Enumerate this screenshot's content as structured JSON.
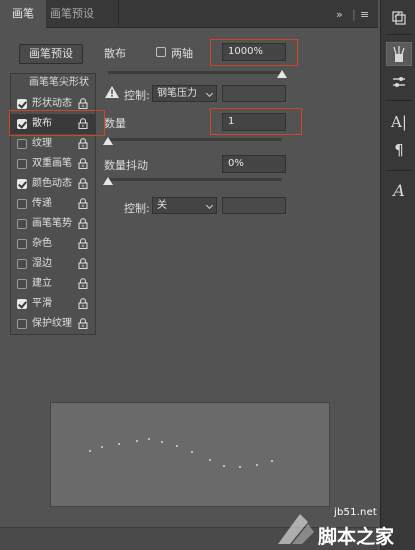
{
  "tabs": {
    "active": "画笔",
    "second": "画笔预设"
  },
  "tabbar": {
    "collapse": "»",
    "menu": "≡"
  },
  "left": {
    "preset_button": "画笔预设",
    "header": "画笔笔尖形状",
    "items": [
      {
        "label": "形状动态",
        "checked": true
      },
      {
        "label": "散布",
        "checked": true,
        "selected": true
      },
      {
        "label": "纹理",
        "checked": false
      },
      {
        "label": "双重画笔",
        "checked": false
      },
      {
        "label": "颜色动态",
        "checked": true
      },
      {
        "label": "传递",
        "checked": false
      },
      {
        "label": "画笔笔势",
        "checked": false
      },
      {
        "label": "杂色",
        "checked": false
      },
      {
        "label": "湿边",
        "checked": false
      },
      {
        "label": "建立",
        "checked": false
      },
      {
        "label": "平滑",
        "checked": true
      },
      {
        "label": "保护纹理",
        "checked": false
      }
    ]
  },
  "scatter": {
    "label": "散布",
    "both_axes_label": "两轴",
    "both_axes_checked": false,
    "value": "1000%",
    "slider_fraction": 1.0,
    "control_label": "控制:",
    "control_value": "钢笔压力"
  },
  "count": {
    "label": "数量",
    "value": "1",
    "slider_fraction": 0.0
  },
  "count_jitter": {
    "label": "数量抖动",
    "value": "0%",
    "slider_fraction": 0.0,
    "control_label": "控制:",
    "control_value": "关"
  },
  "watermark": {
    "url": "jb51.net",
    "text": "脚本之家"
  },
  "colors": {
    "panel_bg": "#535353",
    "highlight": "#d0442a"
  }
}
